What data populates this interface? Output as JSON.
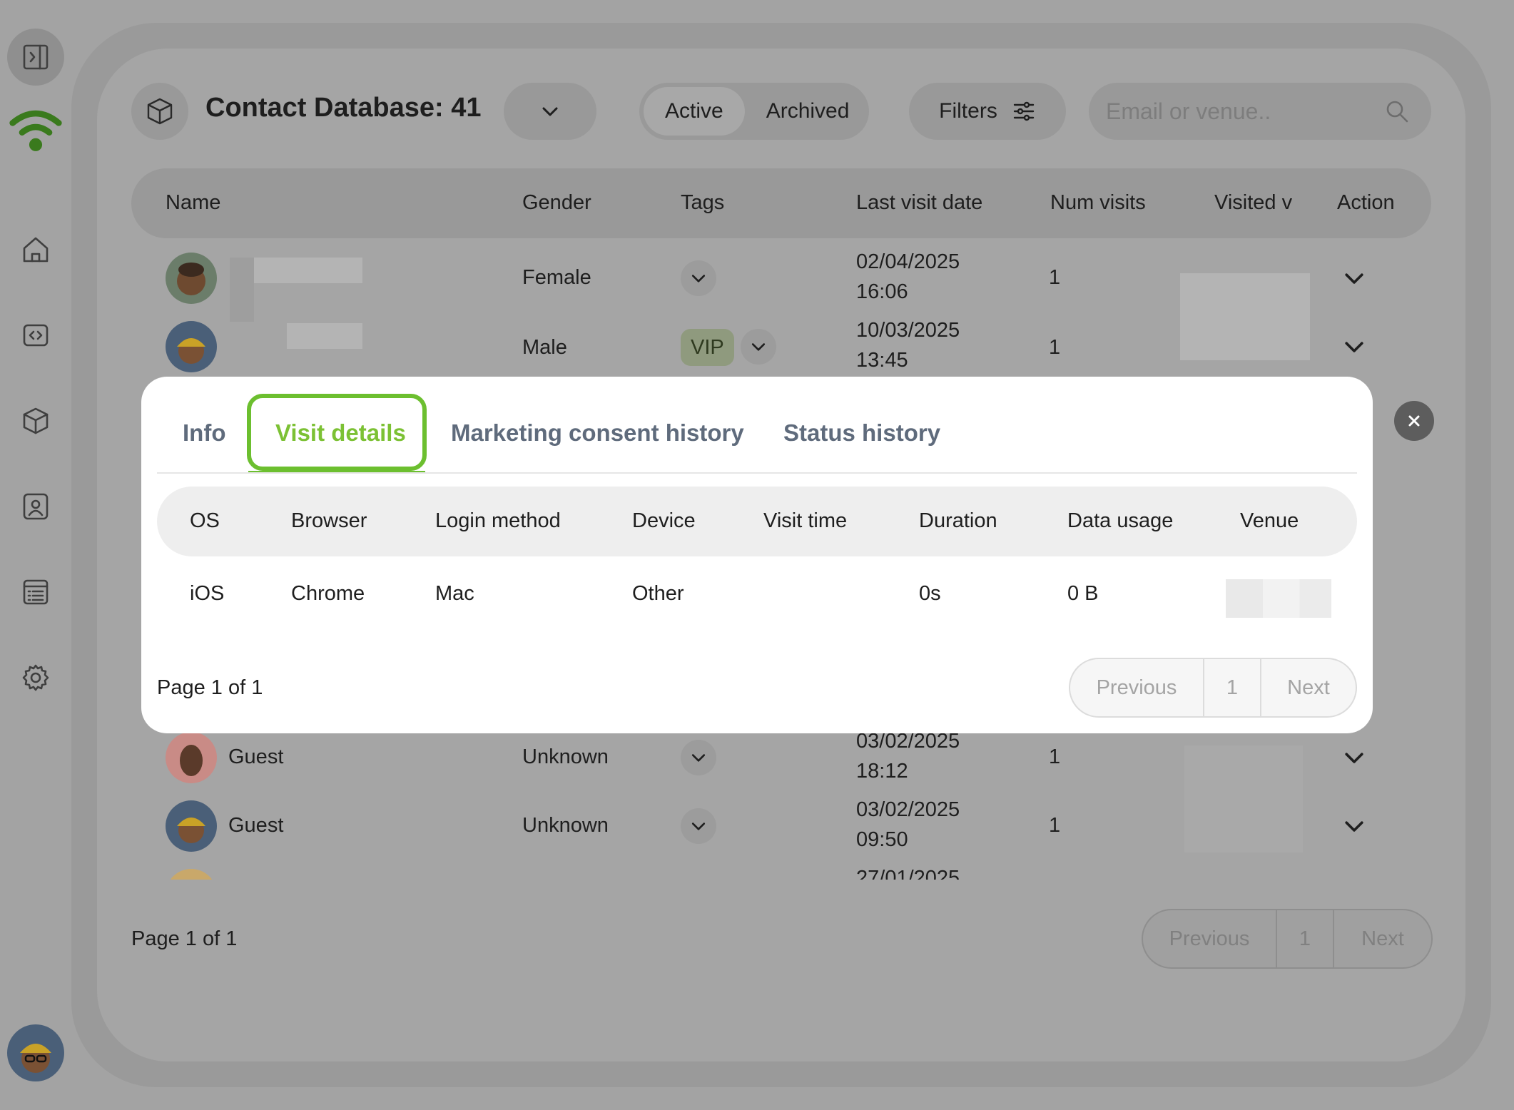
{
  "header": {
    "title": "Contact Database: 41",
    "status_tabs": [
      "Active",
      "Archived"
    ],
    "active_status": "Active",
    "filters_label": "Filters",
    "search_placeholder": "Email or venue.."
  },
  "table": {
    "columns": [
      "Name",
      "Gender",
      "Tags",
      "Last visit date",
      "Num visits",
      "Visited v",
      "Action"
    ],
    "rows": [
      {
        "name": "",
        "gender": "Female",
        "tag": "",
        "date": "02/04/2025",
        "time": "16:06",
        "visits": "1"
      },
      {
        "name": "",
        "gender": "Male",
        "tag": "VIP",
        "date": "10/03/2025",
        "time": "13:45",
        "visits": "1"
      },
      {
        "name": "Guest",
        "gender": "Unknown",
        "tag": "",
        "date": "03/02/2025",
        "time": "18:12",
        "visits": "1"
      },
      {
        "name": "Guest",
        "gender": "Unknown",
        "tag": "",
        "date": "03/02/2025",
        "time": "09:50",
        "visits": "1"
      },
      {
        "name": "",
        "gender": "",
        "tag": "",
        "date": "27/01/2025",
        "time": "",
        "visits": ""
      }
    ]
  },
  "pagination": {
    "text": "Page 1 of 1",
    "previous": "Previous",
    "page": "1",
    "next": "Next"
  },
  "modal": {
    "tabs": [
      "Info",
      "Visit details",
      "Marketing consent history",
      "Status history"
    ],
    "active_tab": "Visit details",
    "columns": [
      "OS",
      "Browser",
      "Login method",
      "Device",
      "Visit time",
      "Duration",
      "Data usage",
      "Venue"
    ],
    "rows": [
      {
        "os": "iOS",
        "browser": "Chrome",
        "login_method": "Mac",
        "device": "Other",
        "visit_time": "",
        "duration": "0s",
        "data_usage": "0 B",
        "venue": ""
      }
    ],
    "pagination": {
      "text": "Page 1 of 1",
      "previous": "Previous",
      "page": "1",
      "next": "Next"
    }
  },
  "colors": {
    "brand_green": "#6cbf2f",
    "overlay_gray": "#a3a3a3",
    "tab_inactive": "#5f6b7c"
  },
  "icons": {
    "sidebar": [
      "sidebar-toggle-icon",
      "wifi-logo-icon",
      "home-icon",
      "code-icon",
      "cube-icon",
      "contacts-icon",
      "list-icon",
      "settings-icon"
    ],
    "close": "close-icon"
  }
}
